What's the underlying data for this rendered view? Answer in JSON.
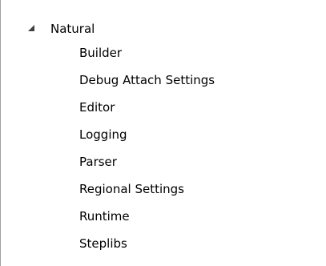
{
  "tree": {
    "root": {
      "label": "Natural",
      "expanded": true,
      "expander_icon": "triangle-expanded-icon",
      "children": [
        {
          "label": "Builder"
        },
        {
          "label": "Debug Attach Settings"
        },
        {
          "label": "Editor"
        },
        {
          "label": "Logging"
        },
        {
          "label": "Parser"
        },
        {
          "label": "Regional Settings"
        },
        {
          "label": "Runtime"
        },
        {
          "label": "Steplibs"
        }
      ]
    }
  },
  "colors": {
    "text": "#000000",
    "background": "#ffffff",
    "border": "#a0a0a0",
    "expander": "#404040"
  }
}
